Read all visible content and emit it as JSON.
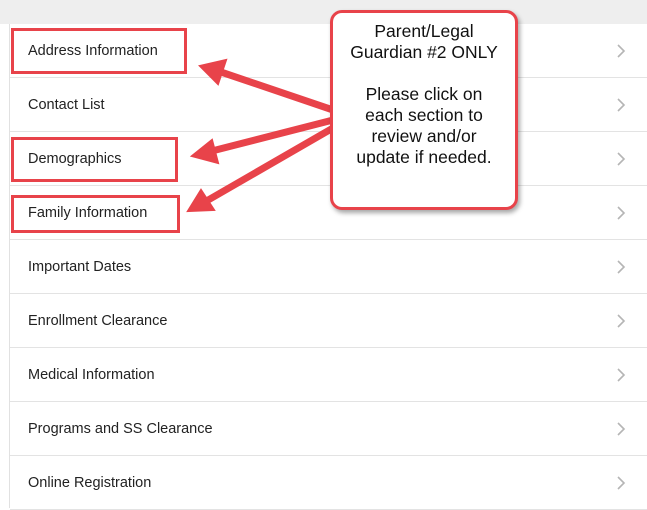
{
  "menu": {
    "items": [
      {
        "label": "Address Information"
      },
      {
        "label": "Contact List"
      },
      {
        "label": "Demographics"
      },
      {
        "label": "Family Information"
      },
      {
        "label": "Important Dates"
      },
      {
        "label": "Enrollment Clearance"
      },
      {
        "label": "Medical Information"
      },
      {
        "label": "Programs and SS Clearance"
      },
      {
        "label": "Online Registration"
      }
    ],
    "chevron_icon": "chevron-right-icon"
  },
  "callout": {
    "lines": [
      "Parent/Legal",
      "Guardian #2 ONLY",
      "",
      "Please click on",
      "each section to",
      "review and/or",
      "update if needed."
    ]
  },
  "colors": {
    "annotation_red": "#e8434a",
    "row_divider": "#e3e3e3",
    "chevron": "#b5b5b5",
    "text": "#222222"
  }
}
